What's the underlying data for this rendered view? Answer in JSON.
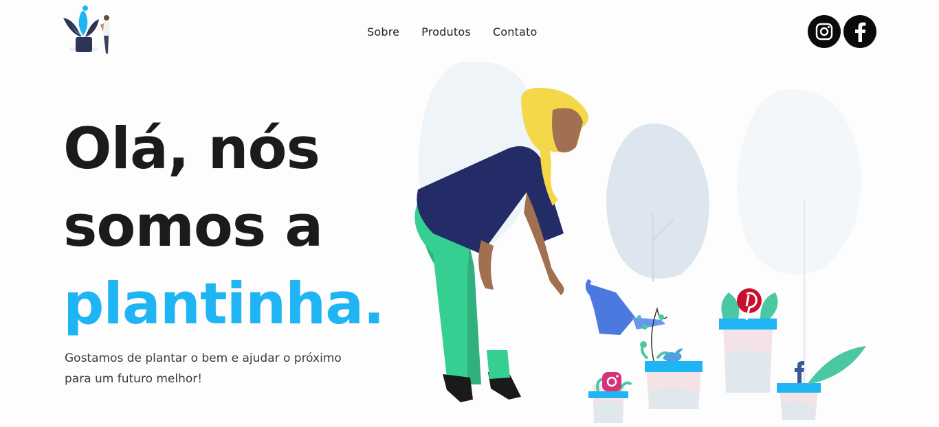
{
  "nav": {
    "items": [
      "Sobre",
      "Produtos",
      "Contato"
    ]
  },
  "social": {
    "instagram_icon": "instagram-icon",
    "facebook_icon": "facebook-icon"
  },
  "hero": {
    "title_line1": "Olá, nós",
    "title_line2": "somos a",
    "title_accent": "plantinha.",
    "subtitle_line1": "Gostamos de plantar o bem e ajudar o próximo",
    "subtitle_line2": "para um futuro melhor!"
  },
  "colors": {
    "accent": "#1fb4f4",
    "text": "#1b1b1b",
    "background": "#fdfdfd"
  },
  "illustration": {
    "subject": "woman-watering-plants",
    "pot_icons": [
      "instagram-icon",
      "twitter-icon",
      "pinterest-icon",
      "facebook-icon"
    ]
  }
}
